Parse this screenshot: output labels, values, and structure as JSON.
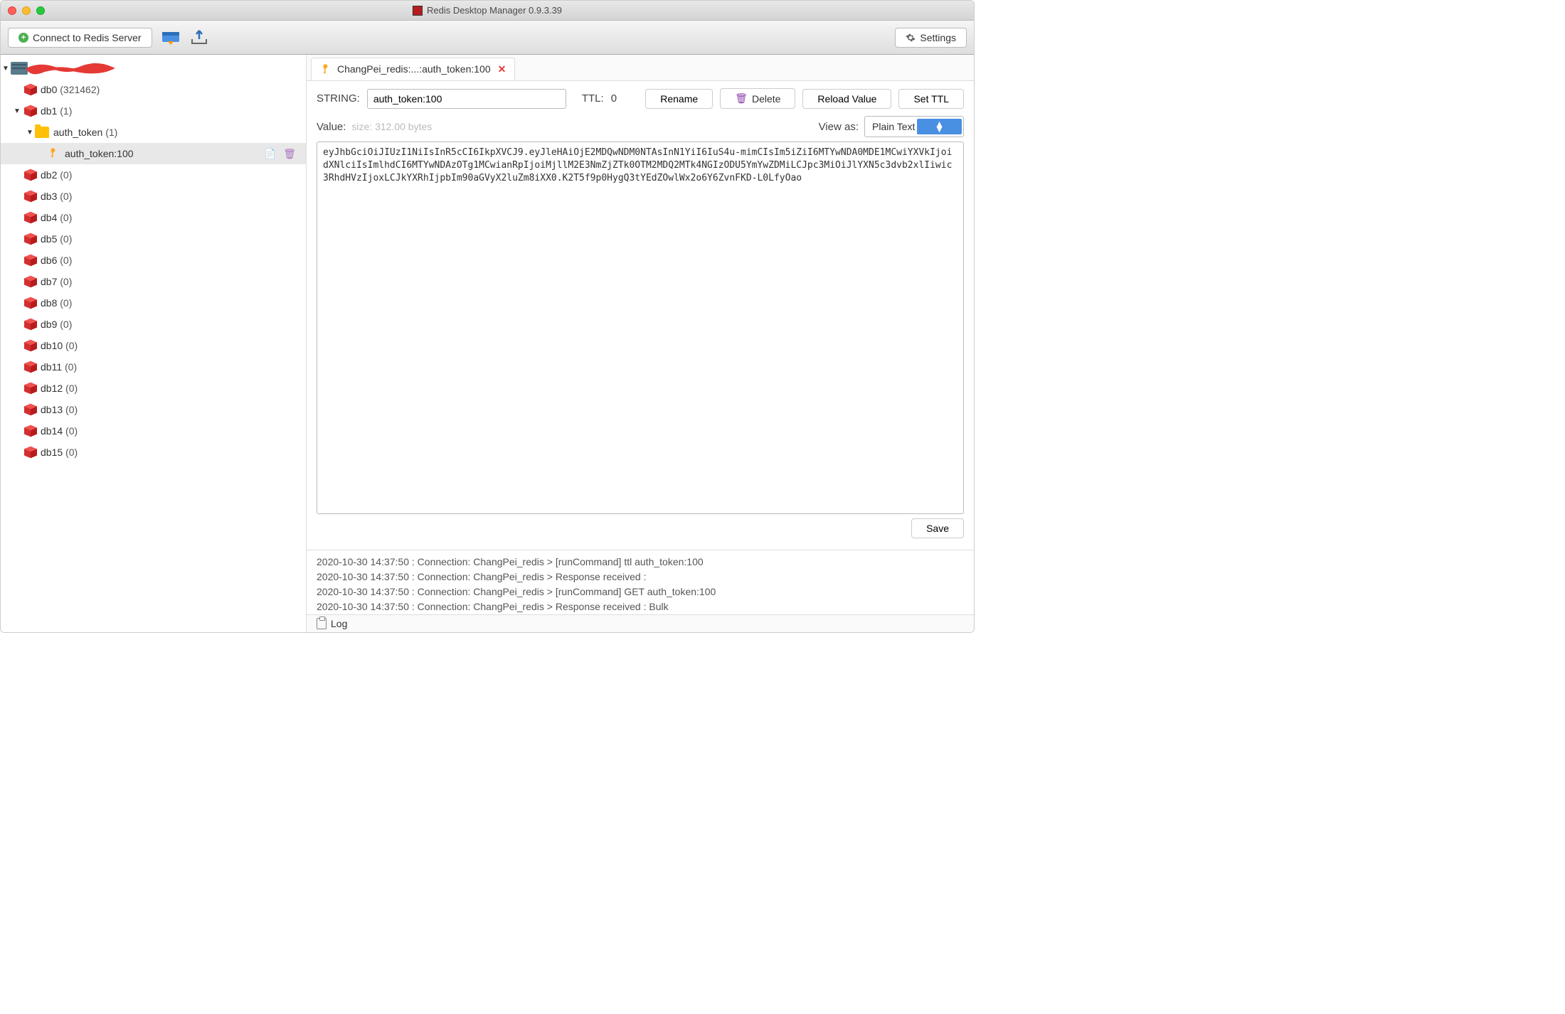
{
  "window": {
    "title": "Redis Desktop Manager 0.9.3.39"
  },
  "toolbar": {
    "connect_label": "Connect to Redis Server",
    "settings_label": "Settings"
  },
  "tree": {
    "server_name_redacted": true,
    "databases": [
      {
        "name": "db0",
        "count": "(321462)",
        "expanded": false
      },
      {
        "name": "db1",
        "count": "(1)",
        "expanded": true,
        "folders": [
          {
            "name": "auth_token",
            "count": "(1)",
            "expanded": true,
            "keys": [
              {
                "name": "auth_token:100",
                "selected": true
              }
            ]
          }
        ]
      },
      {
        "name": "db2",
        "count": "(0)"
      },
      {
        "name": "db3",
        "count": "(0)"
      },
      {
        "name": "db4",
        "count": "(0)"
      },
      {
        "name": "db5",
        "count": "(0)"
      },
      {
        "name": "db6",
        "count": "(0)"
      },
      {
        "name": "db7",
        "count": "(0)"
      },
      {
        "name": "db8",
        "count": "(0)"
      },
      {
        "name": "db9",
        "count": "(0)"
      },
      {
        "name": "db10",
        "count": "(0)"
      },
      {
        "name": "db11",
        "count": "(0)"
      },
      {
        "name": "db12",
        "count": "(0)"
      },
      {
        "name": "db13",
        "count": "(0)"
      },
      {
        "name": "db14",
        "count": "(0)"
      },
      {
        "name": "db15",
        "count": "(0)"
      }
    ]
  },
  "tab": {
    "title": "ChangPei_redis:...:auth_token:100"
  },
  "key": {
    "type_label": "STRING:",
    "name": "auth_token:100",
    "ttl_label": "TTL:",
    "ttl_value": "0",
    "rename_btn": "Rename",
    "delete_btn": "Delete",
    "reload_btn": "Reload Value",
    "setttl_btn": "Set TTL",
    "value_label": "Value:",
    "size_text": "size: 312.00 bytes",
    "viewas_label": "View as:",
    "viewas_value": "Plain Text",
    "value": "eyJhbGciOiJIUzI1NiIsInR5cCI6IkpXVCJ9.eyJleHAiOjE2MDQwNDM0NTAsInN1YiI6IuS4u-mimCIsIm5iZiI6MTYwNDA0MDE1MCwiYXVkIjoidXNlciIsImlhdCI6MTYwNDAzOTg1MCwianRpIjoiMjllM2E3NmZjZTk0OTM2MDQ2MTk4NGIzODU5YmYwZDMiLCJpc3MiOiJlYXN5c3dvb2xlIiwic3RhdHVzIjoxLCJkYXRhIjpbIm90aGVyX2luZm8iXX0.K2T5f9p0HygQ3tYEdZOwlWx2o6Y6ZvnFKD-L0LfyOao",
    "save_btn": "Save"
  },
  "log": {
    "lines": [
      "2020-10-30 14:37:50 : Connection: ChangPei_redis > [runCommand] ttl auth_token:100",
      "2020-10-30 14:37:50 : Connection: ChangPei_redis > Response received :",
      "2020-10-30 14:37:50 : Connection: ChangPei_redis > [runCommand] GET auth_token:100",
      "2020-10-30 14:37:50 : Connection: ChangPei_redis > Response received : Bulk"
    ],
    "tab_label": "Log"
  }
}
